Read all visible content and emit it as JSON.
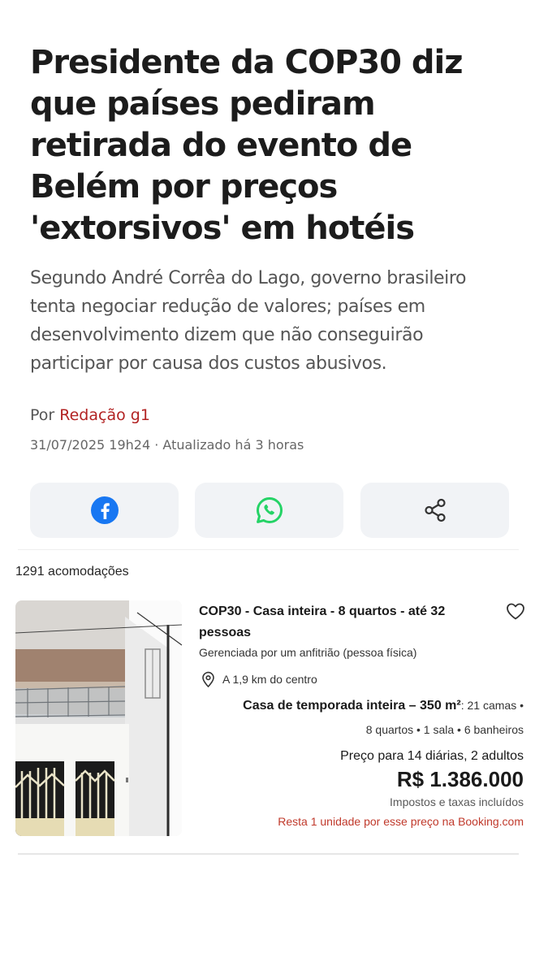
{
  "article": {
    "headline": "Presidente da COP30 diz que países pediram retirada do evento de Belém por preços 'extorsivos' em hotéis",
    "subtitle": "Segundo André Corrêa do Lago, governo brasileiro tenta negociar redução de valores; países em desenvolvimento dizem que não conseguirão participar por causa dos custos abusivos.",
    "byline_prefix": "Por ",
    "author": "Redação g1",
    "dateline": "31/07/2025 19h24 · Atualizado há 3 horas"
  },
  "share": {
    "facebook_icon": "facebook-icon",
    "whatsapp_icon": "whatsapp-icon",
    "share_icon": "share-icon",
    "colors": {
      "facebook": "#1877f2",
      "whatsapp": "#25d366",
      "share": "#333333",
      "button_bg": "#f1f3f6"
    }
  },
  "listing": {
    "count": "1291 acomodações",
    "title": "COP30 - Casa inteira - 8 quartos - até 32 pessoas",
    "host": "Gerenciada por um anfitrião (pessoa física)",
    "distance": "A 1,9 km do centro",
    "unit_name": "Casa de temporada inteira – 350 m²",
    "unit_details_1": ": 21 camas •",
    "unit_details_2": "8 quartos • 1 sala • 6 banheiros",
    "price_label": "Preço para 14 diárias, 2 adultos",
    "price": "R$ 1.386.000",
    "taxes": "Impostos e taxas incluídos",
    "scarcity": "Resta 1 unidade por esse preço na Booking.com",
    "icons": {
      "favorite": "heart-icon",
      "location": "map-pin-icon"
    },
    "colors": {
      "author": "#b22222",
      "scarcity": "#c0392b"
    }
  }
}
